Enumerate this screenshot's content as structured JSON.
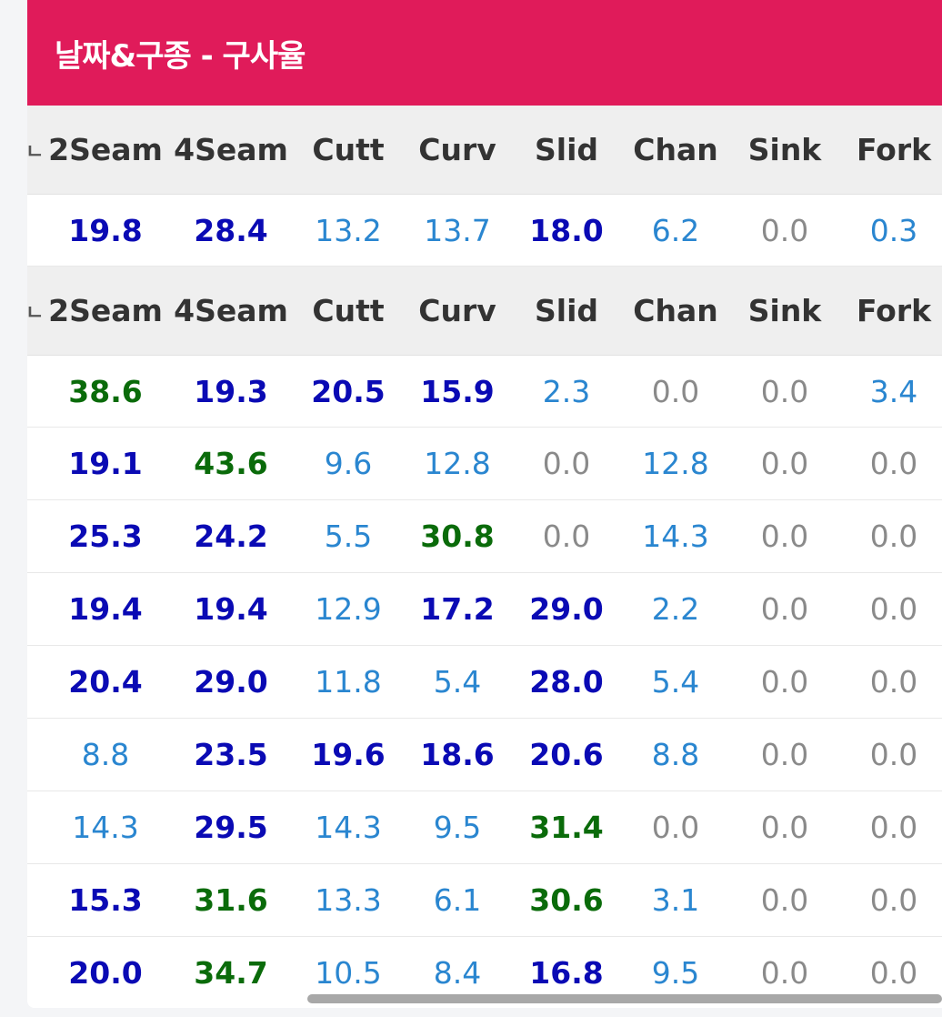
{
  "title": "날짜&구종 - 구사율",
  "columns": [
    "2Seam",
    "4Seam",
    "Cutt",
    "Curv",
    "Slid",
    "Chan",
    "Sink",
    "Fork"
  ],
  "colors": {
    "header_bg": "#e01b5a",
    "blue": "#0a0ab4",
    "green": "#0a6b0a",
    "light_blue": "#2a86d0",
    "gray": "#8a8a8a"
  },
  "cut_mark": "ㄴ",
  "groups": [
    {
      "rows": [
        [
          "19.8",
          "28.4",
          "13.2",
          "13.7",
          "18.0",
          "6.2",
          "0.0",
          "0.3"
        ]
      ]
    },
    {
      "rows": [
        [
          "38.6",
          "19.3",
          "20.5",
          "15.9",
          "2.3",
          "0.0",
          "0.0",
          "3.4"
        ],
        [
          "19.1",
          "43.6",
          "9.6",
          "12.8",
          "0.0",
          "12.8",
          "0.0",
          "0.0"
        ],
        [
          "25.3",
          "24.2",
          "5.5",
          "30.8",
          "0.0",
          "14.3",
          "0.0",
          "0.0"
        ],
        [
          "19.4",
          "19.4",
          "12.9",
          "17.2",
          "29.0",
          "2.2",
          "0.0",
          "0.0"
        ],
        [
          "20.4",
          "29.0",
          "11.8",
          "5.4",
          "28.0",
          "5.4",
          "0.0",
          "0.0"
        ],
        [
          "8.8",
          "23.5",
          "19.6",
          "18.6",
          "20.6",
          "8.8",
          "0.0",
          "0.0"
        ],
        [
          "14.3",
          "29.5",
          "14.3",
          "9.5",
          "31.4",
          "0.0",
          "0.0",
          "0.0"
        ],
        [
          "15.3",
          "31.6",
          "13.3",
          "6.1",
          "30.6",
          "3.1",
          "0.0",
          "0.0"
        ],
        [
          "20.0",
          "34.7",
          "10.5",
          "8.4",
          "16.8",
          "9.5",
          "0.0",
          "0.0"
        ]
      ]
    }
  ]
}
